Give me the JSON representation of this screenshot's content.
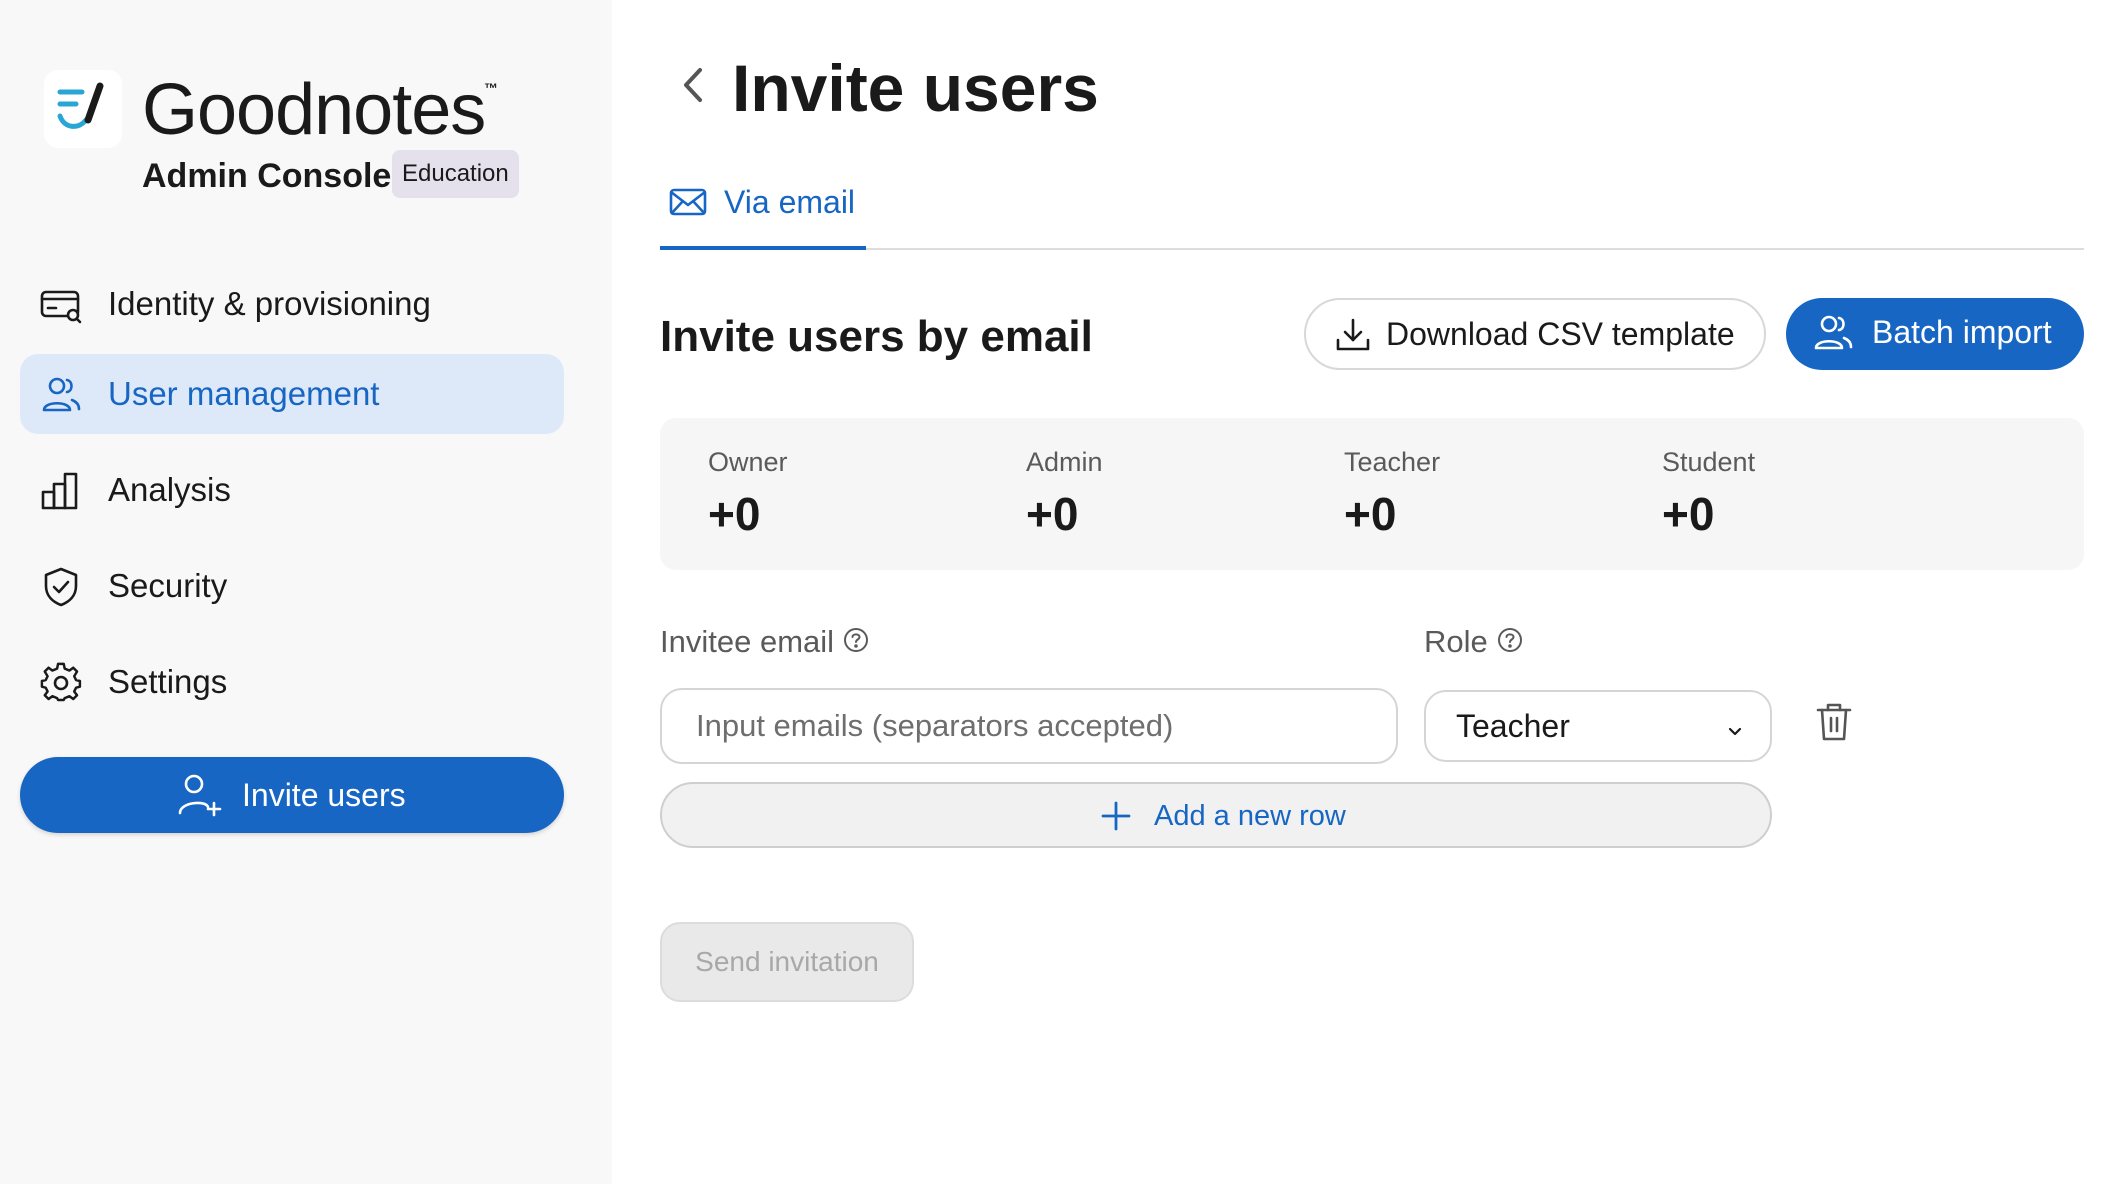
{
  "brand": {
    "name": "Goodnotes",
    "tm": "™",
    "console": "Admin Console",
    "badge": "Education",
    "logo_icon": "goodnotes-logo-icon"
  },
  "sidebar": {
    "items": [
      {
        "label": "Identity & provisioning",
        "icon": "identity-card-icon",
        "active": false
      },
      {
        "label": "User management",
        "icon": "users-icon",
        "active": true
      },
      {
        "label": "Analysis",
        "icon": "bar-chart-icon",
        "active": false
      },
      {
        "label": "Security",
        "icon": "shield-check-icon",
        "active": false
      },
      {
        "label": "Settings",
        "icon": "gear-icon",
        "active": false
      }
    ],
    "invite_button": "Invite users"
  },
  "header": {
    "title": "Invite users"
  },
  "tabs": [
    {
      "label": "Via email",
      "icon": "envelope-icon",
      "active": true
    }
  ],
  "section": {
    "title": "Invite users by email",
    "download_button": "Download CSV template",
    "batch_button": "Batch import"
  },
  "stats": [
    {
      "label": "Owner",
      "value": "+0"
    },
    {
      "label": "Admin",
      "value": "+0"
    },
    {
      "label": "Teacher",
      "value": "+0"
    },
    {
      "label": "Student",
      "value": "+0"
    }
  ],
  "form": {
    "email_label": "Invitee email",
    "role_label": "Role",
    "email_value": "",
    "email_placeholder": "Input emails (separators accepted)",
    "role_value": "Teacher",
    "add_row": "Add a new row",
    "send_button": "Send invitation"
  },
  "colors": {
    "accent": "#1766c4",
    "active_bg": "#dde9f8",
    "sidebar_bg": "#f8f8f8"
  }
}
